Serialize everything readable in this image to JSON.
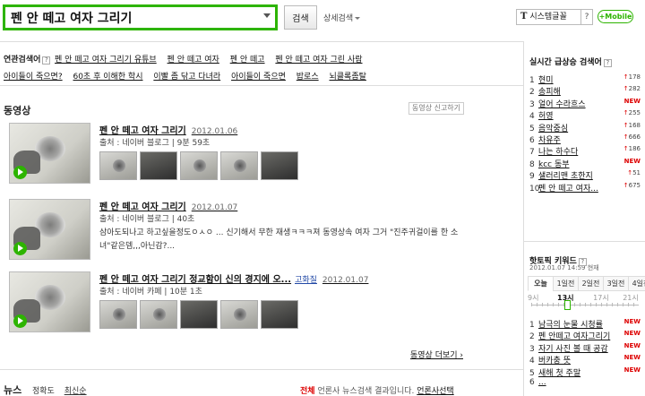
{
  "search": {
    "query": "펜 안 떼고 여자 그리기",
    "button": "검색",
    "detail": "상세검색"
  },
  "header": {
    "font_select": "시스템글꼴",
    "font_icon": "T",
    "help": "?",
    "mobile": "+Mobile"
  },
  "related": {
    "label": "연관검색어",
    "help": "?",
    "row1": [
      "펜 안 떼고 여자 그리기 유튜브",
      "펜 안 떼고 여자",
      "펜 안 떼고",
      "펜 안 떼고 여자 그린 사람"
    ],
    "row2": [
      "아이들이 죽으면?",
      "60초 후 이해한 학시",
      "이빨 좀 닦고 다녀라",
      "아이들이 죽으면",
      "밥로스",
      "뇌클록좀탈"
    ]
  },
  "video_section": {
    "title": "동영상",
    "report": "동영상 신고하기",
    "more": "동영상 더보기",
    "items": [
      {
        "title": "펜 안 떼고 여자 그리기",
        "date": "2012.01.06",
        "meta": "출처 : 네이버 블로그  |  9분 59초",
        "desc": ""
      },
      {
        "title": "펜 안 떼고 여자 그리기",
        "date": "2012.01.07",
        "meta": "출처 : 네이버 블로그  |  40초",
        "desc": "삼아도되나고 하고싶을정도ㅇㅅㅇ ... 신기해서 무한 재생ㅋㅋㅋ져 동영상속 여자 그거 \"진주귀걸이를 한 소녀\"같은뎀,,,아닌감?..."
      },
      {
        "title": "펜 안 떼고 여자 그리기 정교함이 신의 경지에 오...",
        "date": "2012.01.07",
        "meta": "출처 : 네이버 카페  |  10분 1초",
        "desc": "",
        "badge": "고화질"
      }
    ]
  },
  "news": {
    "title": "뉴스",
    "sort": [
      "정확도",
      "최신순"
    ],
    "right_prefix": "전체",
    "right_text": "언론사 뉴스검색 결과입니다.",
    "right_link": "언론사선택"
  },
  "realtime": {
    "title": "실시간 급상승 검색어",
    "help": "?",
    "items": [
      {
        "rank": "1",
        "text": "현미",
        "change": "178",
        "dir": "up"
      },
      {
        "rank": "2",
        "text": "송피해",
        "change": "282",
        "dir": "up"
      },
      {
        "rank": "3",
        "text": "얼어 수라흐스",
        "change": "NEW",
        "dir": "new"
      },
      {
        "rank": "4",
        "text": "허영",
        "change": "255",
        "dir": "up"
      },
      {
        "rank": "5",
        "text": "음악중심",
        "change": "168",
        "dir": "up"
      },
      {
        "rank": "6",
        "text": "차유주",
        "change": "666",
        "dir": "up"
      },
      {
        "rank": "7",
        "text": "나는 하수다",
        "change": "186",
        "dir": "up"
      },
      {
        "rank": "8",
        "text": "kcc 동부",
        "change": "NEW",
        "dir": "new"
      },
      {
        "rank": "9",
        "text": "샐러리맨 초한지",
        "change": "51",
        "dir": "up"
      },
      {
        "rank": "10",
        "text": "펜 안 떼고 여자...",
        "change": "675",
        "dir": "up"
      }
    ],
    "time": "2012.01.07 14:59 현재"
  },
  "hot": {
    "title": "핫토픽 키워드",
    "help": "?",
    "tabs": [
      "오늘",
      "1일전",
      "2일전",
      "3일전",
      "4일전"
    ],
    "active_tab": 0,
    "time_labels": [
      "9시",
      "13시",
      "17시",
      "21시"
    ],
    "active_time": 1,
    "slider_position": 0.33,
    "items": [
      {
        "rank": "1",
        "text": "남극의 눈물 시청률",
        "change": "NEW"
      },
      {
        "rank": "2",
        "text": "펜 안떼고 여자그리기",
        "change": "NEW"
      },
      {
        "rank": "3",
        "text": "자기 사진 볼 때 공감",
        "change": "NEW"
      },
      {
        "rank": "4",
        "text": "버카충 뜻",
        "change": "NEW"
      },
      {
        "rank": "5",
        "text": "새해 첫 주말",
        "change": "NEW"
      },
      {
        "rank": "6",
        "text": "...",
        "change": ""
      }
    ]
  }
}
